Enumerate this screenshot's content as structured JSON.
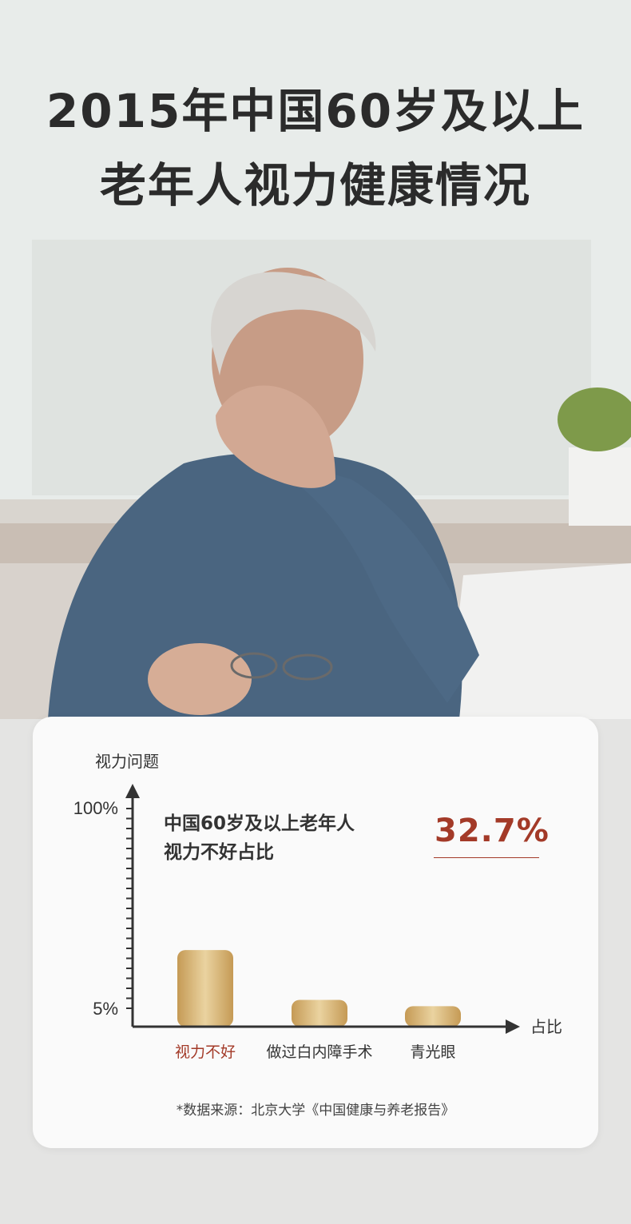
{
  "title_line1": "2015年中国60岁及以上",
  "title_line2": "老年人视力健康情况",
  "chart_data": {
    "type": "bar",
    "ylabel": "视力问题",
    "xlabel": "占比",
    "ytick_top": "100%",
    "ytick_bottom": "5%",
    "categories": [
      "视力不好",
      "做过白内障手术",
      "青光眼"
    ],
    "values": [
      32.7,
      9,
      6
    ],
    "ylim": [
      5,
      100
    ],
    "highlight_category": "视力不好",
    "annotation_line1": "中国60岁及以上老年人",
    "annotation_line2": "视力不好占比",
    "annotation_value": "32.7%",
    "source": "*数据来源：北京大学《中国健康与养老报告》"
  },
  "colors": {
    "accent": "#a33a28",
    "bar_light": "#ead3a0",
    "bar_dark": "#c59a55",
    "axis": "#333333"
  }
}
